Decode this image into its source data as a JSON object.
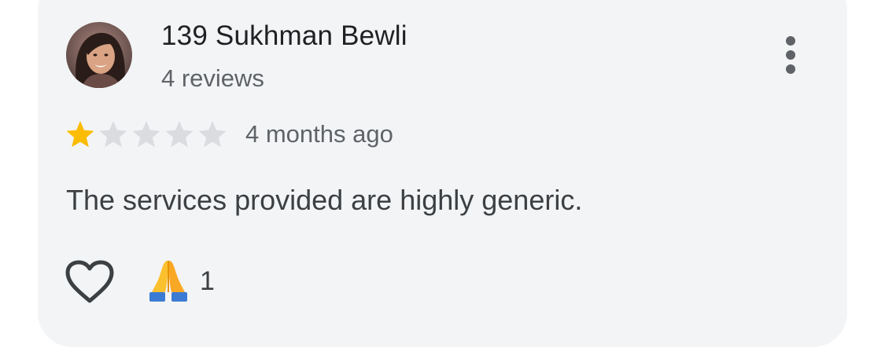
{
  "review": {
    "reviewer_name": "139 Sukhman Bewli",
    "review_count": "4 reviews",
    "rating": 1,
    "rating_max": 5,
    "time_ago": "4 months ago",
    "text": "The services provided are highly generic.",
    "reaction_emoji": "🙏",
    "reaction_count": "1"
  },
  "icons": {
    "avatar": "profile-photo",
    "menu": "more-vertical-icon",
    "like": "heart-outline-icon",
    "star_filled": "star-filled-icon",
    "star_empty": "star-empty-icon"
  },
  "colors": {
    "card_background": "#f3f4f6",
    "star_filled": "#fbbc04",
    "star_empty": "#dadce0",
    "primary_text": "#202124",
    "secondary_text": "#5f6368"
  }
}
